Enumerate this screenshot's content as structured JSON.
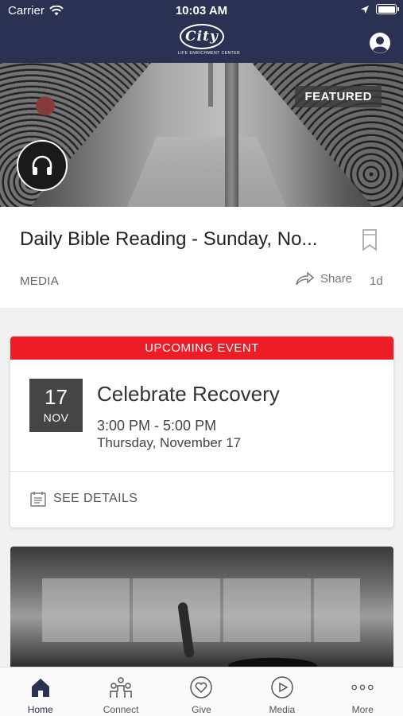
{
  "status_bar": {
    "carrier": "Carrier",
    "time": "10:03 AM"
  },
  "header": {
    "logo_text": "City",
    "logo_subtitle": "LIFE ENRICHMENT CENTER"
  },
  "featured": {
    "badge": "FEATURED",
    "title": "Daily Bible Reading - Sunday, No...",
    "category": "MEDIA",
    "share_label": "Share",
    "age": "1d"
  },
  "event": {
    "banner": "UPCOMING EVENT",
    "day": "17",
    "month": "NOV",
    "title": "Celebrate Recovery",
    "time_range": "3:00 PM - 5:00 PM",
    "date_text": "Thursday, November 17",
    "details_label": "SEE DETAILS"
  },
  "tabs": [
    {
      "label": "Home",
      "icon": "home-icon",
      "active": true
    },
    {
      "label": "Connect",
      "icon": "people-icon",
      "active": false
    },
    {
      "label": "Give",
      "icon": "heart-icon",
      "active": false
    },
    {
      "label": "Media",
      "icon": "play-icon",
      "active": false
    },
    {
      "label": "More",
      "icon": "more-icon",
      "active": false
    }
  ],
  "colors": {
    "header_bg": "#2a3152",
    "event_banner": "#ee1c25",
    "date_box": "#454545"
  }
}
